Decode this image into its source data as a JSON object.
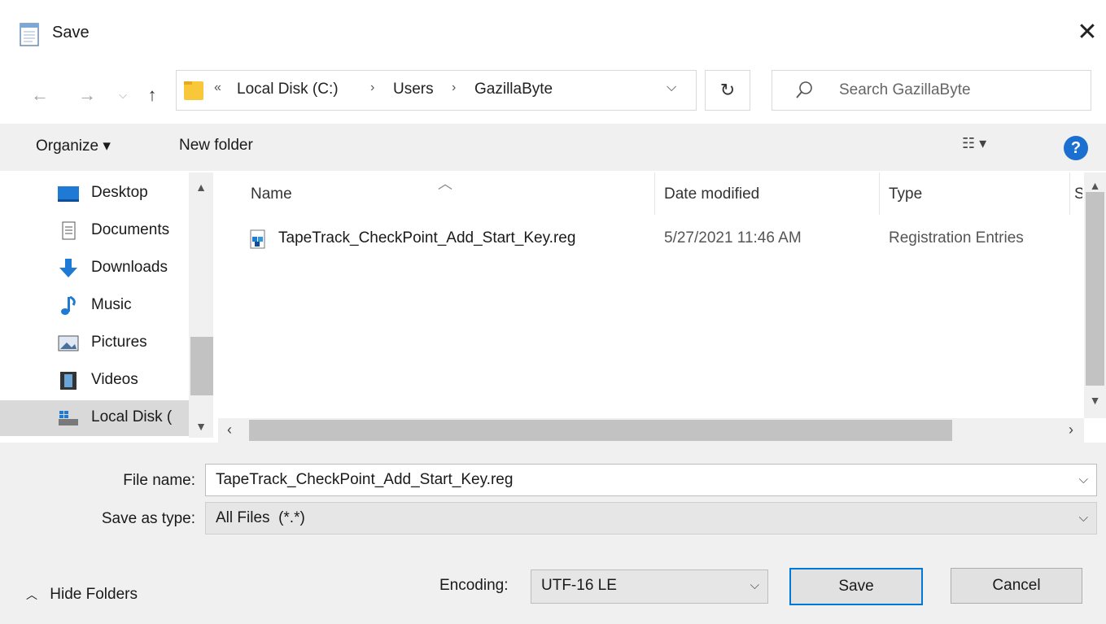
{
  "window": {
    "title": "Save"
  },
  "nav": {
    "back_icon": "arrow-left-icon",
    "forward_icon": "arrow-right-icon",
    "recent_icon": "chevron-down-icon",
    "up_icon": "arrow-up-icon",
    "overflow": "«",
    "breadcrumbs": [
      "Local Disk (C:)",
      "Users",
      "GazillaByte"
    ],
    "refresh_icon": "refresh-icon"
  },
  "search": {
    "placeholder": "Search GazillaByte"
  },
  "toolbar": {
    "organize_label": "Organize ▾",
    "new_folder_label": "New folder",
    "help_label": "?"
  },
  "sidebar": {
    "items": [
      {
        "label": "Desktop",
        "icon": "desktop-icon"
      },
      {
        "label": "Documents",
        "icon": "documents-icon"
      },
      {
        "label": "Downloads",
        "icon": "downloads-icon"
      },
      {
        "label": "Music",
        "icon": "music-icon"
      },
      {
        "label": "Pictures",
        "icon": "pictures-icon"
      },
      {
        "label": "Videos",
        "icon": "videos-icon"
      },
      {
        "label": "Local Disk (",
        "icon": "local-disk-icon",
        "selected": true
      }
    ]
  },
  "filelist": {
    "columns": [
      "Name",
      "Date modified",
      "Type",
      "S"
    ],
    "rows": [
      {
        "name": "TapeTrack_CheckPoint_Add_Start_Key.reg",
        "date": "5/27/2021 11:46 AM",
        "type": "Registration Entries",
        "icon": "registry-file-icon"
      }
    ]
  },
  "form": {
    "filename_label": "File name:",
    "filename_value": "TapeTrack_CheckPoint_Add_Start_Key.reg",
    "savetype_label": "Save as type:",
    "savetype_value": "All Files  (*.*)",
    "encoding_label": "Encoding:",
    "encoding_value": "UTF-16 LE",
    "hide_folders_label": "Hide Folders",
    "save_label": "Save",
    "cancel_label": "Cancel"
  },
  "colors": {
    "accent": "#0078d7",
    "help": "#1a6fd1",
    "selection": "#d9d9d9",
    "folder": "#f8c73a"
  }
}
